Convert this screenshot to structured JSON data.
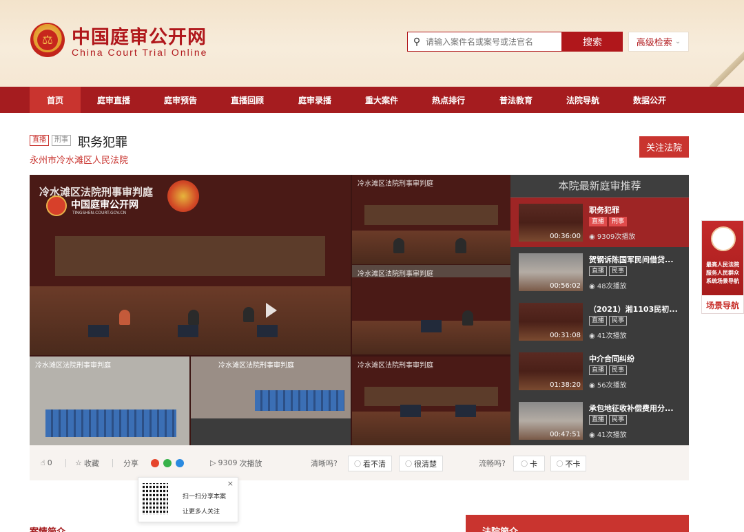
{
  "header": {
    "title": "中国庭审公开网",
    "subtitle": "China Court Trial Online",
    "search_placeholder": "请输入案件名或案号或法官名",
    "search_button": "搜索",
    "advanced_search": "高级检索"
  },
  "nav": [
    "首页",
    "庭审直播",
    "庭审预告",
    "直播回顾",
    "庭审录播",
    "重大案件",
    "热点排行",
    "普法教育",
    "法院导航",
    "数据公开"
  ],
  "case": {
    "tag_live": "直播",
    "tag_type": "刑事",
    "title": "职务犯罪",
    "court": "永州市冷水滩区人民法院",
    "follow_button": "关注法院"
  },
  "video": {
    "main_label": "冷水滩区法院刑事审判庭",
    "logo_text": "中国庭审公开网",
    "logo_url": "TINGSHEN.COURT.GOV.CN",
    "pane_labels": [
      "冷水滩区法院刑事审判庭",
      "冷水滩区法院刑事审判庭",
      "冷水滩区法院刑事审判庭",
      "冷水滩区法院刑事审判庭",
      "冷水滩区法院刑事审判庭"
    ]
  },
  "recommend": {
    "title": "本院最新庭审推荐",
    "items": [
      {
        "name": "职务犯罪",
        "tags": [
          "直播",
          "刑事"
        ],
        "duration": "00:36:00",
        "plays": "9309次播放"
      },
      {
        "name": "贺钢诉陈国军民间借贷...",
        "tags": [
          "直播",
          "民事"
        ],
        "duration": "00:56:02",
        "plays": "48次播放"
      },
      {
        "name": "（2021）湘1103民初...",
        "tags": [
          "直播",
          "民事"
        ],
        "duration": "00:31:08",
        "plays": "41次播放"
      },
      {
        "name": "中介合同纠纷",
        "tags": [
          "直播",
          "民事"
        ],
        "duration": "01:38:20",
        "plays": "56次播放"
      },
      {
        "name": "承包地征收补偿费用分...",
        "tags": [
          "直播",
          "民事"
        ],
        "duration": "00:47:51",
        "plays": "41次播放"
      }
    ]
  },
  "actions": {
    "likes": "0",
    "favorite": "收藏",
    "share": "分享",
    "plays_count": "9309",
    "plays_suffix": "次播放",
    "clarity_q": "清晰吗?",
    "unclear": "看不清",
    "clear": "很清楚",
    "smooth_q": "流畅吗?",
    "lag": "卡",
    "no_lag": "不卡"
  },
  "share_popup": {
    "line1": "扫一扫分享本案",
    "line2": "让更多人关注",
    "close": "×"
  },
  "bottom": {
    "case_intro": "案情简介",
    "court_intro": "法院简介"
  },
  "float_nav": {
    "text1": "最高人民法院",
    "text2": "服务人民群众",
    "text3": "系统场景导航",
    "link": "场景导航"
  },
  "colors": {
    "brand": "#a51c1f",
    "accent": "#c9342f"
  }
}
